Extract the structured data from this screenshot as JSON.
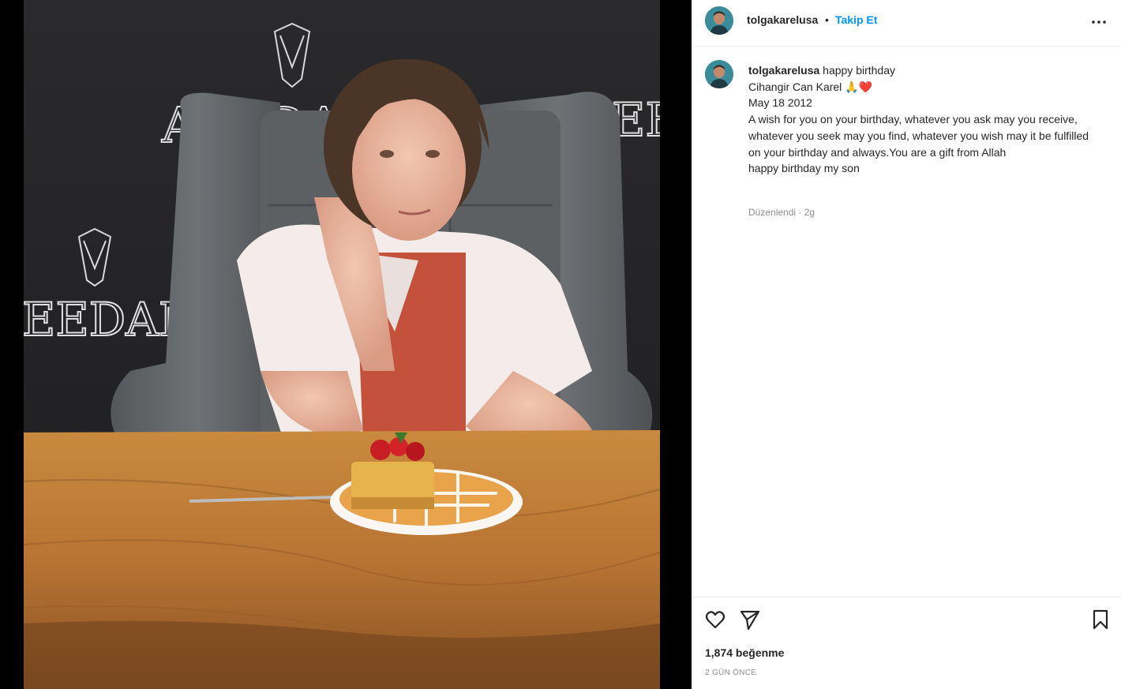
{
  "post": {
    "username": "tolgakarelusa",
    "separator": "•",
    "follow_label": "Takip Et",
    "more_icon": "more-horizontal-icon"
  },
  "caption": {
    "username": "tolgakarelusa",
    "lines": [
      "happy birthday",
      "Cihangir Can Karel 🙏❤️",
      "May 18 2012",
      "A wish for you on your birthday, whatever you ask may you receive, whatever you seek may you find, whatever you wish may it be fulfilled on your birthday and always.You are a gift from Allah",
      "happy birthday my son"
    ],
    "meta": "Düzenlendi · 2g"
  },
  "photo": {
    "backdrop_text_top": "AFEDA",
    "backdrop_text_bottom": "EEDAM",
    "backdrop_text_right": "EE"
  },
  "actions": {
    "like_icon": "heart-icon",
    "share_icon": "send-icon",
    "save_icon": "bookmark-icon",
    "likes": "1,874 beğenme",
    "timestamp": "2 GÜN ÖNCE"
  },
  "colors": {
    "accent": "#0095f6",
    "text": "#262626",
    "muted": "#8e8e8e",
    "divider": "#efefef"
  }
}
